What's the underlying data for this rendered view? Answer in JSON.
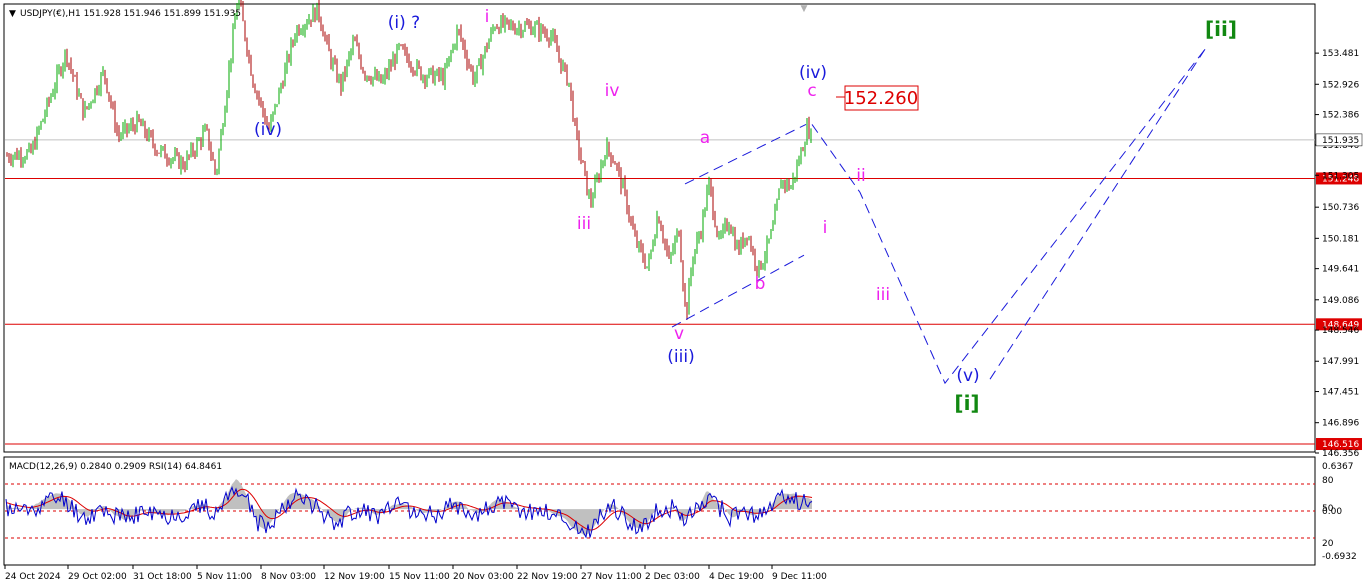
{
  "header": {
    "chart_info": "USDJPY(€),H1  151.928 151.946 151.899 151.935"
  },
  "indicator_header": "MACD(12,26,9) 0.2840 0.2909  RSI(14) 64.8461",
  "colors": {
    "up": "#00aa00",
    "down": "#aa0000",
    "level": "#dd0000",
    "wave_blue": "#1a1adb",
    "wave_magenta": "#ee22ee",
    "wave_green": "#118811",
    "projection": "#1a1adb",
    "macd_hist": "#c0c0c0",
    "rsi": "#0000cc",
    "signal": "#dd0000"
  },
  "chart_data": [
    {
      "type": "line",
      "title": "USDJPY(€),H1",
      "symbol": "USDJPY(€)",
      "timeframe": "H1",
      "ohlc_last": {
        "open": 151.928,
        "high": 151.946,
        "low": 151.899,
        "close": 151.935
      },
      "current_price": 151.935,
      "ylim": [
        146.356,
        154.0
      ],
      "y_ticks": [
        153.481,
        152.926,
        152.386,
        151.846,
        151.305,
        150.736,
        150.181,
        149.641,
        149.086,
        148.546,
        147.991,
        147.451,
        146.896,
        146.356
      ],
      "y_tick_labels": [
        "153.481",
        "152.926",
        "152.386",
        "151.846",
        "151.305",
        "150.736",
        "150.181",
        "149.641",
        "149.086",
        "148.546",
        "147.991",
        "147.451",
        "146.896",
        "146.356"
      ],
      "x_tick_labels": [
        "24 Oct 2024",
        "29 Oct 02:00",
        "31 Oct 18:00",
        "5 Nov 11:00",
        "8 Nov 03:00",
        "12 Nov 19:00",
        "15 Nov 11:00",
        "20 Nov 03:00",
        "22 Nov 19:00",
        "27 Nov 11:00",
        "2 Dec 03:00",
        "4 Dec 19:00",
        "9 Dec 11:00"
      ],
      "horizontal_levels": [
        {
          "label": "151.248",
          "value": 151.248
        },
        {
          "label": "148.649",
          "value": 148.649
        },
        {
          "label": "146.516",
          "value": 146.516
        }
      ],
      "price_label_box": "152.260",
      "price_label_value": 152.26,
      "price_path_anchor_index": [
        0,
        25,
        60,
        78,
        98,
        112,
        132,
        152,
        178,
        200,
        210,
        232,
        247,
        263,
        290,
        312,
        324,
        335,
        348,
        358,
        376,
        393,
        416,
        438,
        452,
        468,
        489,
        503,
        526,
        545,
        555,
        563,
        570,
        578,
        584,
        591,
        600,
        609,
        618,
        629,
        642,
        652,
        663,
        673,
        680,
        686,
        695,
        703,
        713,
        723,
        732,
        741,
        752,
        760,
        767,
        775,
        785,
        795,
        802,
        806
      ],
      "price_path_anchor_value": [
        151.65,
        151.7,
        153.5,
        152.4,
        153.15,
        152.0,
        152.25,
        151.75,
        151.5,
        152.1,
        151.3,
        154.5,
        153.0,
        152.1,
        153.9,
        154.25,
        153.4,
        152.9,
        153.7,
        153.15,
        152.95,
        153.55,
        153.1,
        153.05,
        153.9,
        153.0,
        154.0,
        153.95,
        153.95,
        153.8,
        153.3,
        152.95,
        152.0,
        151.35,
        150.8,
        151.2,
        151.8,
        151.55,
        151.0,
        150.15,
        149.65,
        150.65,
        149.75,
        150.35,
        148.75,
        149.8,
        150.35,
        151.15,
        150.1,
        150.5,
        149.95,
        150.3,
        149.6,
        149.95,
        150.35,
        151.2,
        151.1,
        151.7,
        152.2,
        151.9
      ],
      "projection_path": [
        {
          "label": "(iv) c",
          "value": 152.21
        },
        {
          "label": "ii",
          "value": 151.0
        },
        {
          "label": "(v)",
          "value": 147.6
        },
        {
          "label": "[ii]",
          "value": 153.55
        }
      ],
      "channel_lines": [
        {
          "from": 151.15,
          "to": 152.21
        },
        {
          "from": 148.6,
          "to": 149.88
        }
      ],
      "wave_labels": [
        {
          "text": "(i) ?",
          "color": "blue"
        },
        {
          "text": "i",
          "color": "magenta"
        },
        {
          "text": "(iv)",
          "color": "blue"
        },
        {
          "text": "iv",
          "color": "magenta"
        },
        {
          "text": "iii",
          "color": "magenta"
        },
        {
          "text": "a",
          "color": "magenta"
        },
        {
          "text": "(iv)",
          "color": "blue"
        },
        {
          "text": "c",
          "color": "magenta"
        },
        {
          "text": "ii",
          "color": "magenta"
        },
        {
          "text": "i",
          "color": "magenta"
        },
        {
          "text": "b",
          "color": "magenta"
        },
        {
          "text": "v",
          "color": "magenta"
        },
        {
          "text": "(iii)",
          "color": "blue"
        },
        {
          "text": "iii",
          "color": "magenta"
        },
        {
          "text": "(v)",
          "color": "blue"
        },
        {
          "text": "[i]",
          "color": "green"
        },
        {
          "text": "[ii]",
          "color": "green"
        }
      ]
    },
    {
      "type": "line",
      "title": "MACD(12,26,9) 0.2840 0.2909  RSI(14) 64.8461",
      "series": [
        {
          "name": "MACD(12,26,9)",
          "last_main": 0.284,
          "last_signal": 0.2909
        },
        {
          "name": "RSI(14)",
          "last": 64.8461
        }
      ],
      "macd_ylim": [
        -0.6932,
        0.6367
      ],
      "rsi_levels": [
        80,
        50,
        20
      ],
      "y_tick_labels": [
        "0.6367",
        "80",
        "50",
        "0.00",
        "20",
        "-0.6932"
      ]
    }
  ]
}
